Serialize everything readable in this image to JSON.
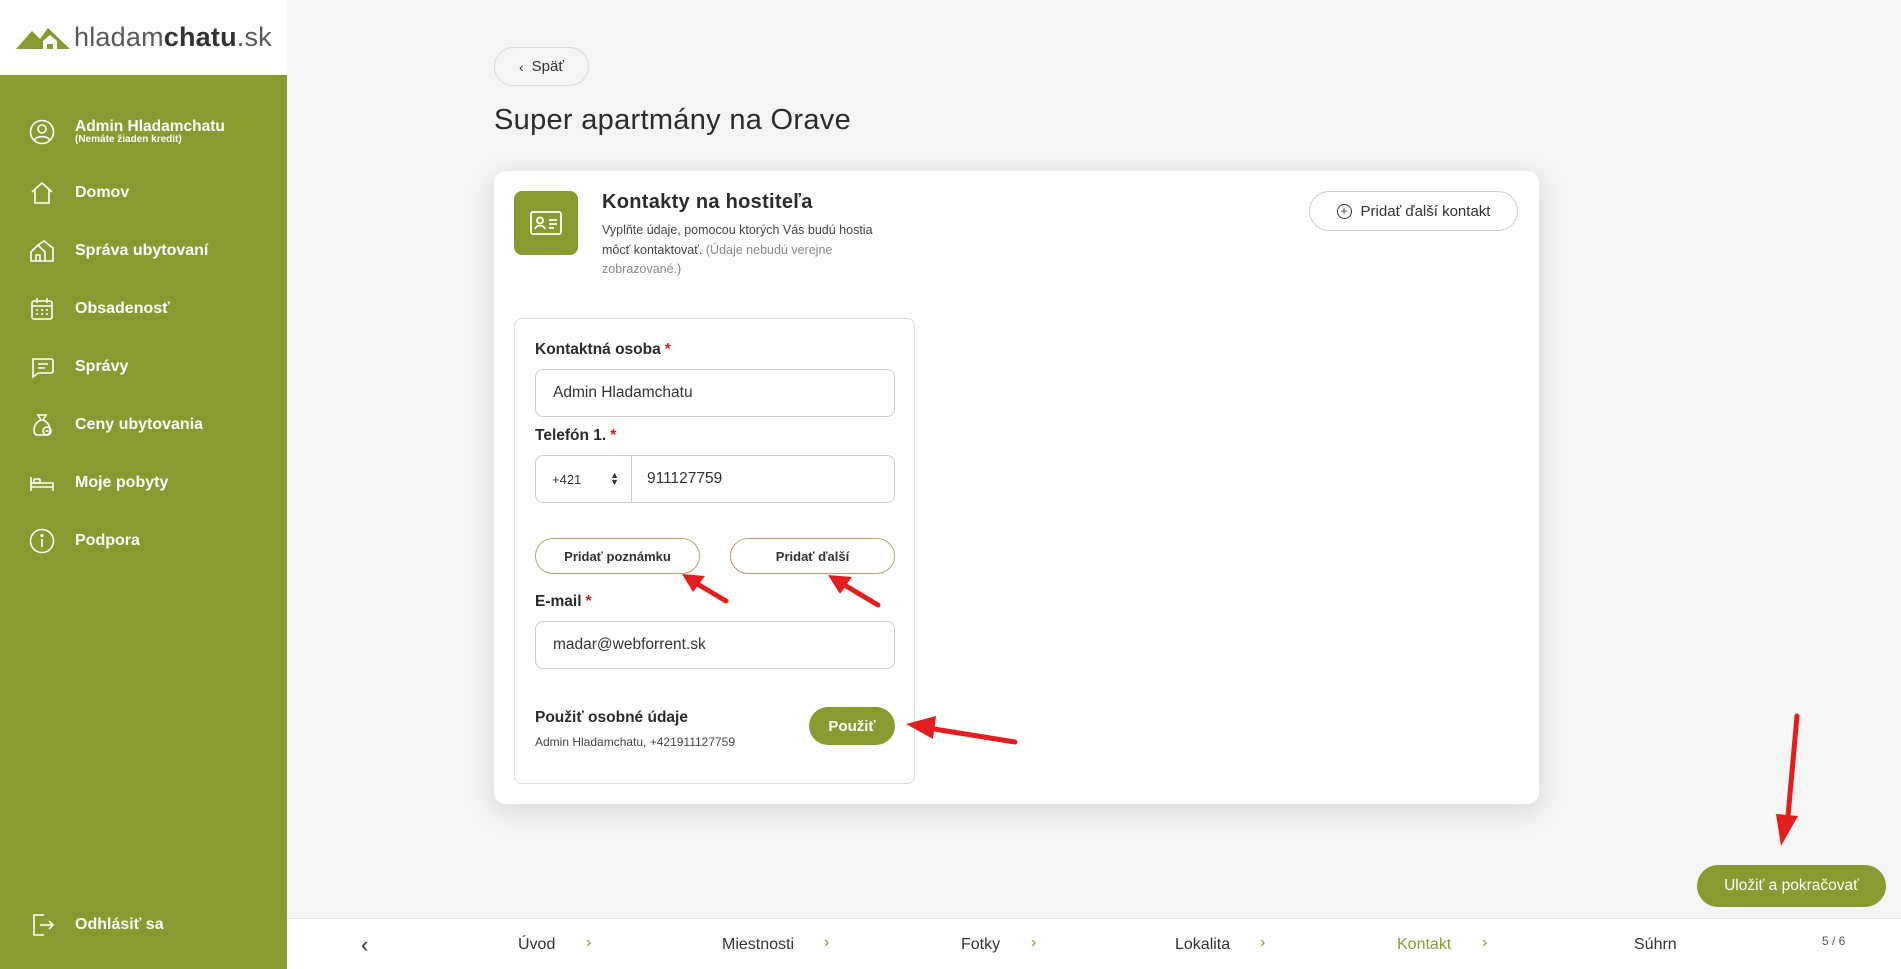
{
  "logo": {
    "prefix": "hladam",
    "bold": "chatu",
    "suffix": ".sk"
  },
  "sidebar": {
    "user": {
      "name": "Admin Hladamchatu",
      "credit": "(Nemáte žiaden kredit)"
    },
    "items": [
      {
        "label": "Domov",
        "icon": "home-icon"
      },
      {
        "label": "Správa ubytovaní",
        "icon": "houses-icon"
      },
      {
        "label": "Obsadenosť",
        "icon": "calendar-icon"
      },
      {
        "label": "Správy",
        "icon": "message-icon"
      },
      {
        "label": "Ceny ubytovania",
        "icon": "money-bag-icon"
      },
      {
        "label": "Moje pobyty",
        "icon": "bed-icon"
      },
      {
        "label": "Podpora",
        "icon": "info-icon"
      }
    ],
    "logout": "Odhlásiť sa"
  },
  "header": {
    "back": "Späť",
    "title": "Super apartmány na Orave"
  },
  "card": {
    "title": "Kontakty na hostiteľa",
    "desc": "Vyplňte údaje, pomocou ktorých Vás budú hostia môcť kontaktovať.",
    "desc_muted": "(Údaje nebudú verejne zobrazované.)",
    "add_contact": "Pridať ďalší kontakt"
  },
  "form": {
    "contact_label": "Kontaktná osoba",
    "contact_value": "Admin Hladamchatu",
    "phone_label": "Telefón 1.",
    "phone_prefix": "+421",
    "phone_value": "911127759",
    "add_note": "Pridať poznámku",
    "add_more": "Pridať ďalší",
    "email_label": "E-mail",
    "email_value": "madar@webforrent.sk",
    "required_mark": "*",
    "personal_label": "Použiť osobné údaje",
    "personal_value": "Admin Hladamchatu, +421911127759",
    "use_btn": "Použiť"
  },
  "save_btn": "Uložiť a pokračovať",
  "steps": {
    "items": [
      "Úvod",
      "Miestnosti",
      "Fotky",
      "Lokalita",
      "Kontakt",
      "Súhrn"
    ],
    "active": "Kontakt",
    "counter": "5 / 6"
  },
  "colors": {
    "brand": "#899a31",
    "annotation": "#e41e1e"
  }
}
